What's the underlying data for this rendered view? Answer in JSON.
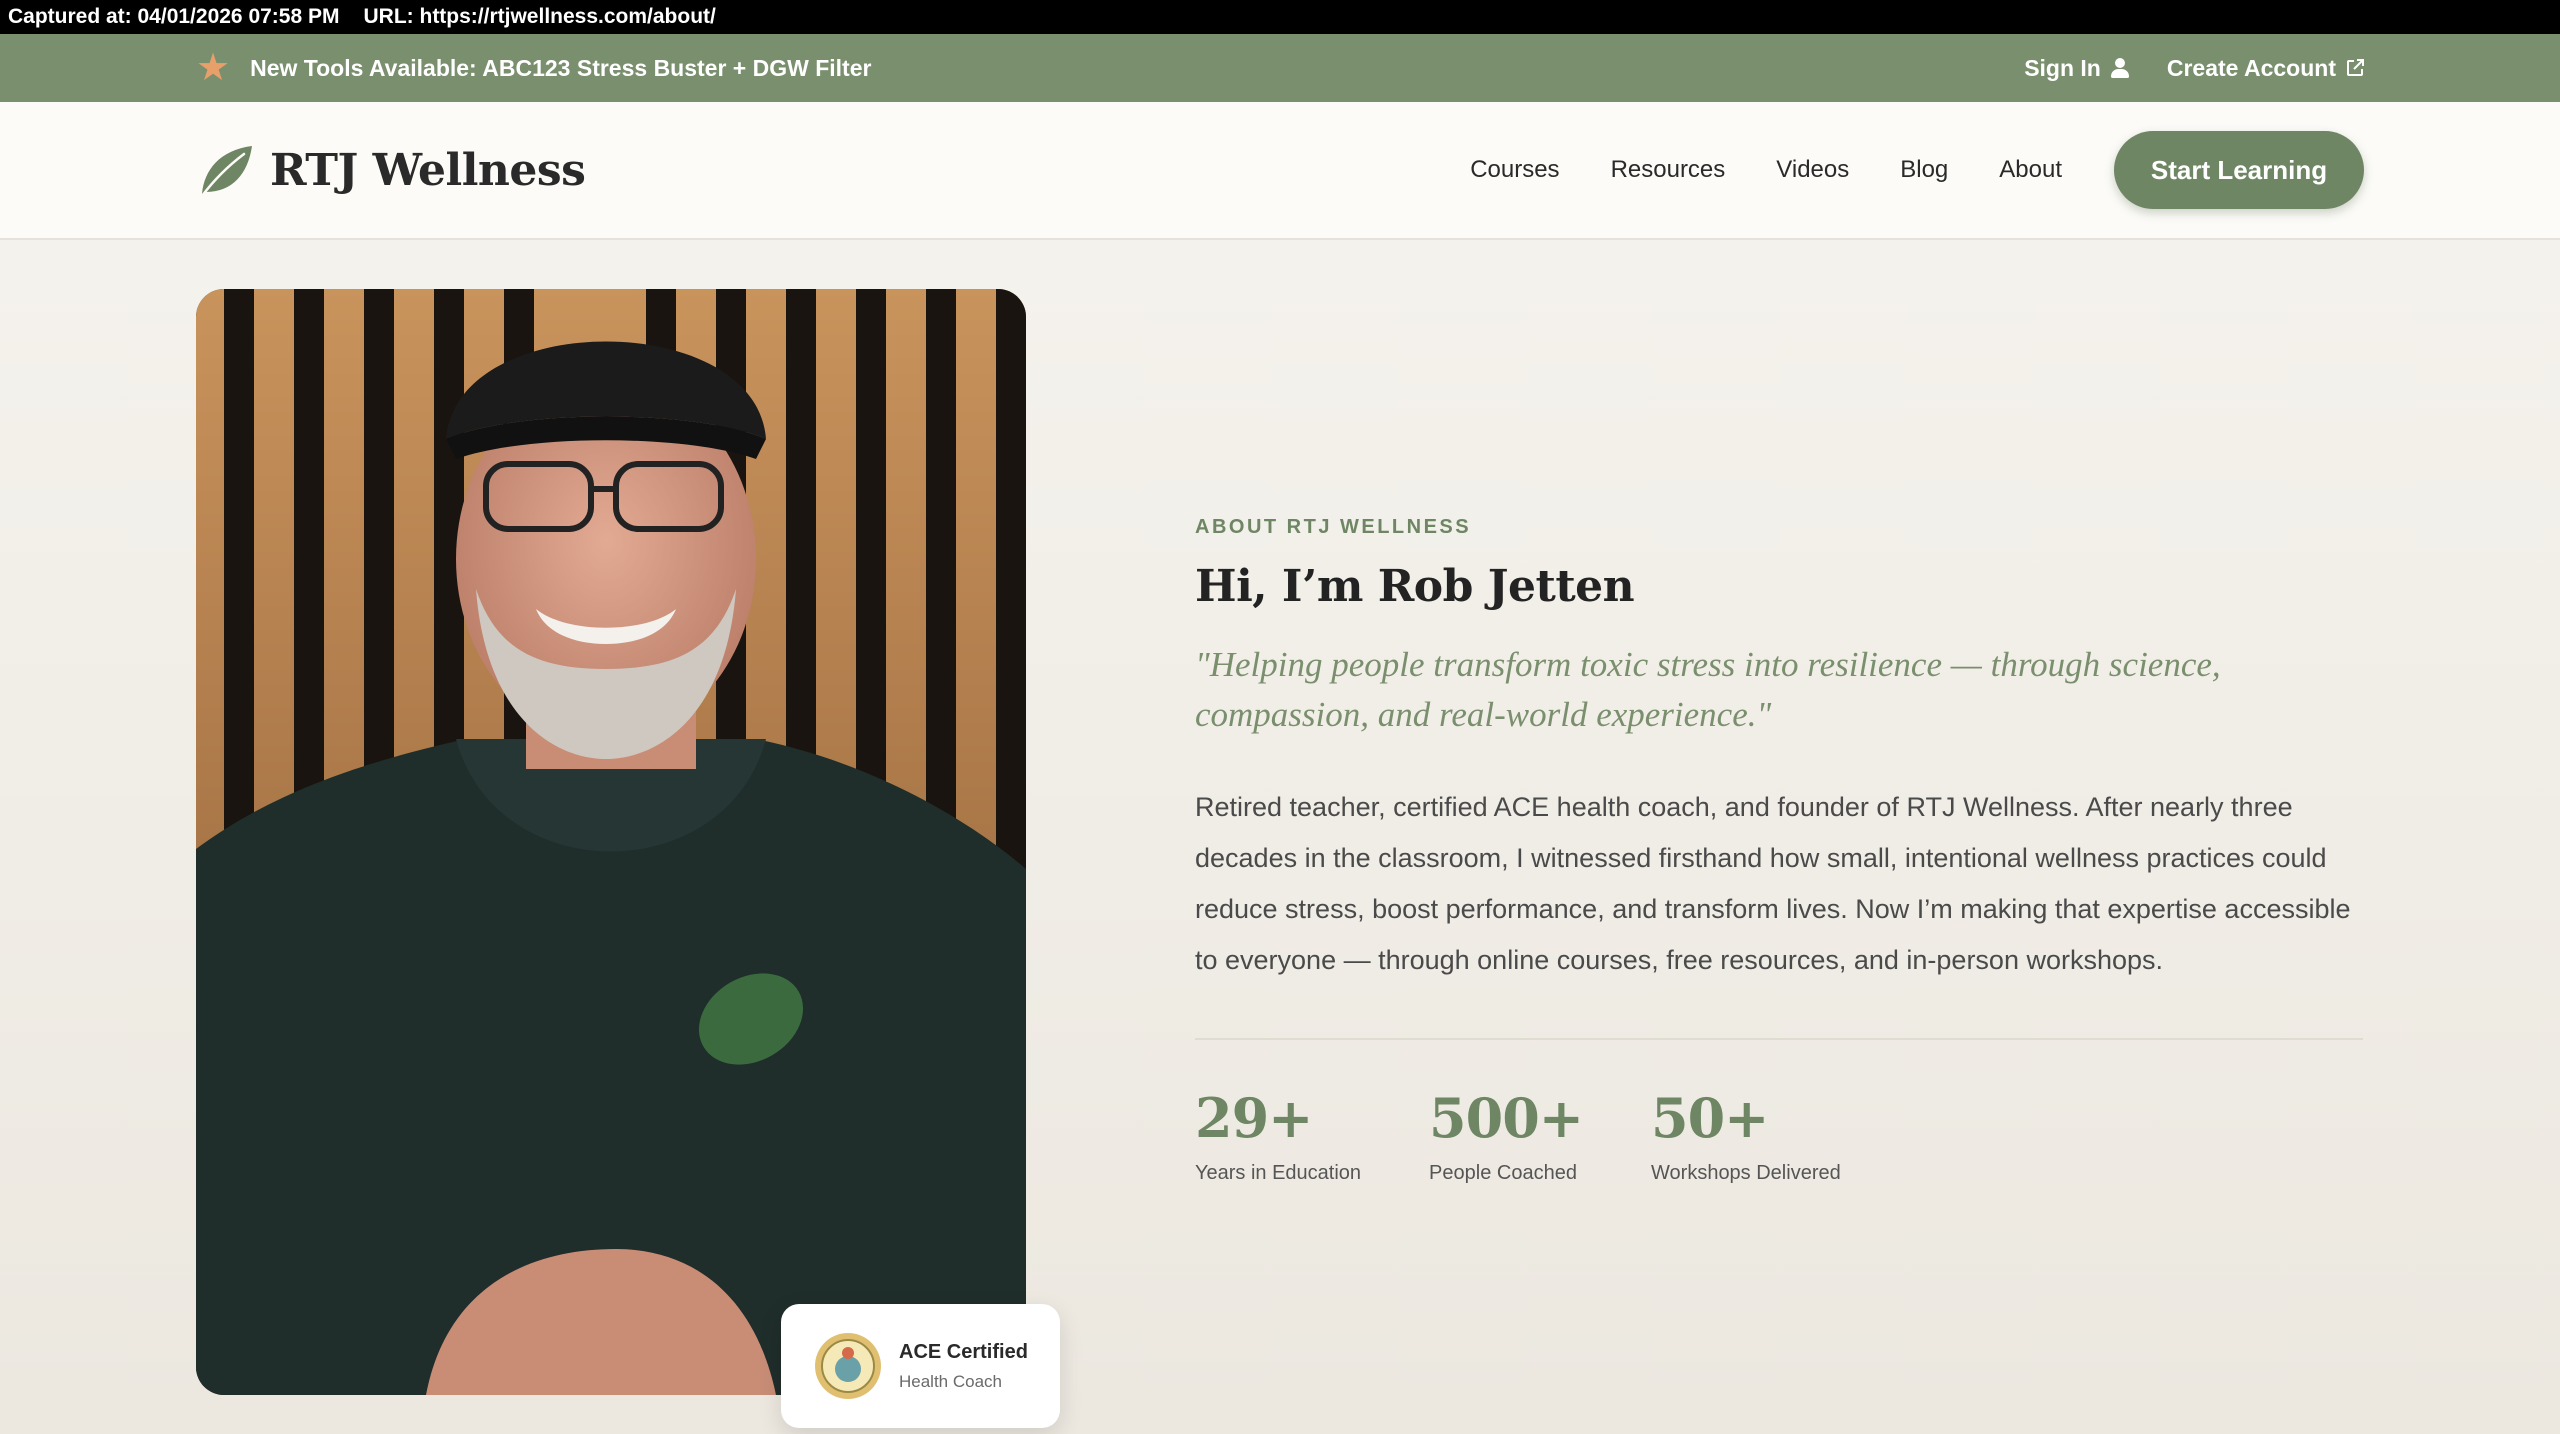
{
  "capture": {
    "timestamp": "Captured at: 04/01/2026 07:58 PM",
    "url": "URL: https://rtjwellness.com/about/"
  },
  "announcement": {
    "icon": "star-icon",
    "text": "New Tools Available: ABC123 Stress Buster + DGW Filter",
    "sign_in": "Sign In",
    "create_account": "Create Account"
  },
  "header": {
    "logo": "RTJ Wellness",
    "nav": [
      "Courses",
      "Resources",
      "Videos",
      "Blog",
      "About"
    ],
    "cta": "Start Learning"
  },
  "certification": {
    "title": "ACE Certified",
    "subtitle": "Health Coach"
  },
  "about": {
    "eyebrow": "ABOUT RTJ WELLNESS",
    "headline": "Hi, I’m Rob Jetten",
    "quote": "\"Helping people transform toxic stress into resilience — through science, compassion, and real-world experience.\"",
    "bio": "Retired teacher, certified ACE health coach, and founder of RTJ Wellness. After nearly three decades in the classroom, I witnessed firsthand how small, intentional wellness practices could reduce stress, boost performance, and transform lives. Now I’m making that expertise accessible to everyone — through online courses, free resources, and in-person workshops.",
    "stats": [
      {
        "value": "29+",
        "label": "Years in Education"
      },
      {
        "value": "500+",
        "label": "People Coached"
      },
      {
        "value": "50+",
        "label": "Workshops Delivered"
      }
    ]
  },
  "colors": {
    "brand_green": "#6e8663",
    "announce_bg": "#7a8f6d",
    "star": "#e8a06b"
  }
}
